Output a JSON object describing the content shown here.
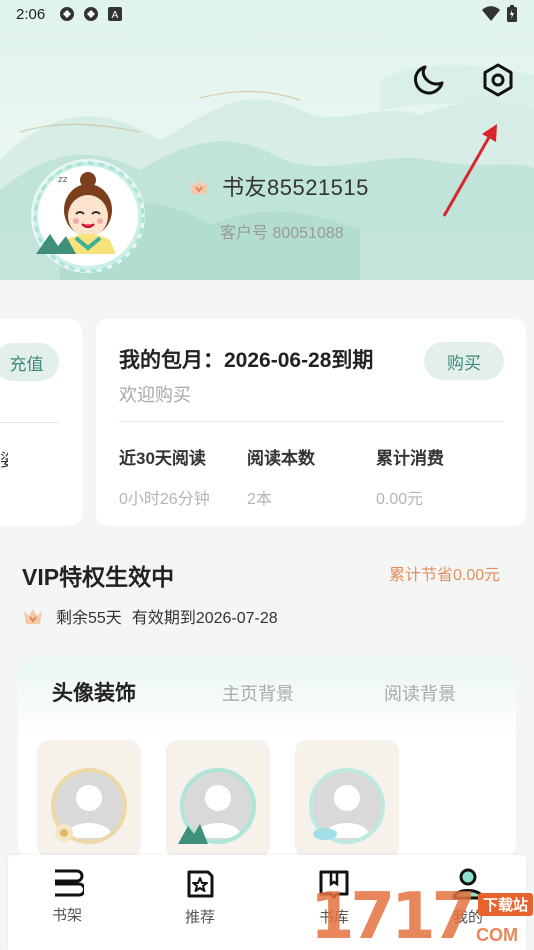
{
  "status_bar": {
    "time": "2:06",
    "icons": [
      "app-icon",
      "app-icon",
      "keyboard-a-icon"
    ],
    "right_icons": [
      "wifi-icon",
      "battery-icon"
    ]
  },
  "header": {
    "night_mode_icon": "moon-icon",
    "settings_icon": "hexagon-settings-icon"
  },
  "profile": {
    "username": "书友85521515",
    "customer_no": "客户号 80051088",
    "badge_icon": "crown-icon"
  },
  "left_card": {
    "recharge_label": "充值",
    "edge_text": "娑"
  },
  "subscription": {
    "title": "我的包月：2026-06-28到期",
    "subtitle": "欢迎购买",
    "buy_label": "购买",
    "stats": [
      {
        "label": "近30天阅读",
        "value": "0小时26分钟"
      },
      {
        "label": "阅读本数",
        "value": "2本"
      },
      {
        "label": "累计消费",
        "value": "0.00元"
      }
    ]
  },
  "vip": {
    "title": "VIP特权生效中",
    "saved": "累计节省0.00元",
    "remaining": "剩余55天",
    "expiry": "有效期到2026-07-28"
  },
  "decorations": {
    "tabs": [
      {
        "label": "头像装饰",
        "active": true
      },
      {
        "label": "主页背景",
        "active": false
      },
      {
        "label": "阅读背景",
        "active": false
      }
    ]
  },
  "bottom_nav": [
    {
      "label": "书架",
      "icon": "bookshelf-icon"
    },
    {
      "label": "推荐",
      "icon": "star-square-icon"
    },
    {
      "label": "书库",
      "icon": "book-open-icon"
    },
    {
      "label": "我的",
      "icon": "person-icon"
    }
  ],
  "watermark": {
    "digits": "1717",
    "tag": "下载站",
    "domain": "COM"
  },
  "colors": {
    "accent": "#3e8a78",
    "accent_bg": "#e3efec",
    "orange": "#e4905e"
  }
}
